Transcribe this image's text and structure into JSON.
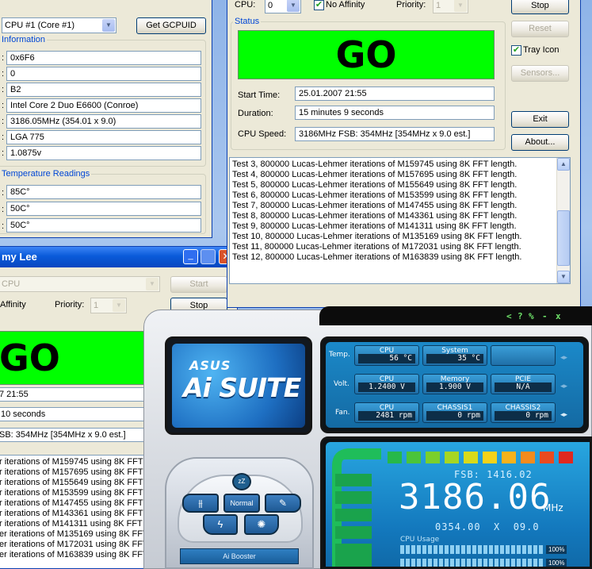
{
  "colors": {
    "go_green": "#00ff00",
    "xp_blue": "#0046d5",
    "title_blue": "#0a5bd9",
    "ai_green": "#6fe36a"
  },
  "window_a": {
    "cpu_select": "CPU #1 (Core #1)",
    "get_gcpuid_label": "Get GCPUID",
    "info_group_title": "Information",
    "info_values": [
      "0x6F6",
      "0",
      "B2",
      "Intel Core 2 Duo E6600 (Conroe)",
      "3186.05MHz (354.01 x 9.0)",
      "LGA 775",
      "1.0875v"
    ],
    "temp_group_title": "Temperature Readings",
    "temp_values": [
      "85C°",
      "50C°",
      "50C°"
    ]
  },
  "window_b": {
    "title": "my Lee",
    "cpu_combo": "CPU",
    "start_label": "Start",
    "affinity_label": "Affinity",
    "priority_label": "Priority:",
    "priority_value": "1",
    "stop_label": "Stop",
    "go_text": "GO",
    "start_time": "7 21:55",
    "duration": "10 seconds",
    "cpu_speed": "SB: 354MHz [354MHz x 9.0 est.]",
    "log_lines": [
      "r iterations of M159745 using 8K FFT",
      "r iterations of M157695 using 8K FFT",
      "r iterations of M155649 using 8K FFT",
      "r iterations of M153599 using 8K FFT",
      "r iterations of M147455 using 8K FFT",
      "r iterations of M143361 using 8K FFT",
      "r iterations of M141311 using 8K FFT",
      "er iterations of M135169 using 8K FFT",
      "er iterations of M172031 using 8K FFT",
      "er iterations of M163839 using 8K FFT"
    ]
  },
  "window_c": {
    "cpu_label": "CPU:",
    "cpu_value": "0",
    "no_affinity_label": "No Affinity",
    "priority_label": "Priority:",
    "priority_value": "1",
    "stop_label": "Stop",
    "status_title": "Status",
    "go_text": "GO",
    "reset_label": "Reset",
    "tray_icon_label": "Tray Icon",
    "sensors_label": "Sensors...",
    "start_time_label": "Start Time:",
    "start_time": "25.01.2007 21:55",
    "duration_label": "Duration:",
    "duration": "15 minutes 9 seconds",
    "cpu_speed_label": "CPU Speed:",
    "cpu_speed": "3186MHz FSB: 354MHz [354MHz x 9.0 est.]",
    "exit_label": "Exit",
    "about_label": "About...",
    "log_lines": [
      "Test 3, 800000 Lucas-Lehmer iterations of M159745 using 8K FFT length.",
      "Test 4, 800000 Lucas-Lehmer iterations of M157695 using 8K FFT length.",
      "Test 5, 800000 Lucas-Lehmer iterations of M155649 using 8K FFT length.",
      "Test 6, 800000 Lucas-Lehmer iterations of M153599 using 8K FFT length.",
      "Test 7, 800000 Lucas-Lehmer iterations of M147455 using 8K FFT length.",
      "Test 8, 800000 Lucas-Lehmer iterations of M143361 using 8K FFT length.",
      "Test 9, 800000 Lucas-Lehmer iterations of M141311 using 8K FFT length.",
      "Test 10, 800000 Lucas-Lehmer iterations of M135169 using 8K FFT length.",
      "Test 11, 800000 Lucas-Lehmer iterations of M172031 using 8K FFT length.",
      "Test 12, 800000 Lucas-Lehmer iterations of M163839 using 8K FFT length."
    ]
  },
  "ai_suite": {
    "controls": [
      "<",
      "?",
      "%",
      "-",
      "x"
    ],
    "brand": "ASUS",
    "product": "Ai SUITE",
    "row_labels": [
      "Temp.",
      "Volt.",
      "Fan."
    ],
    "temp": [
      {
        "name": "CPU",
        "value": "56 °C"
      },
      {
        "name": "System",
        "value": "35 °C"
      }
    ],
    "volt": [
      {
        "name": "CPU",
        "value": "1.2400  V"
      },
      {
        "name": "Memory",
        "value": "1.900  V"
      },
      {
        "name": "PCIE",
        "value": "N/A"
      }
    ],
    "fan": [
      {
        "name": "CPU",
        "value": "2481 rpm"
      },
      {
        "name": "CHASSIS1",
        "value": "0 rpm"
      },
      {
        "name": "CHASSIS2",
        "value": "0 rpm"
      }
    ],
    "fsb": "FSB: 1416.02",
    "frequency": "3186.06",
    "frequency_unit": "MHz",
    "multiplier_line": "0354.00  X  09.0",
    "cpu_usage_label": "CPU Usage",
    "cpu_usage_1": "100%",
    "cpu_usage_2": "100%",
    "booster_mode": "Normal",
    "booster_label": "Ai Booster"
  }
}
